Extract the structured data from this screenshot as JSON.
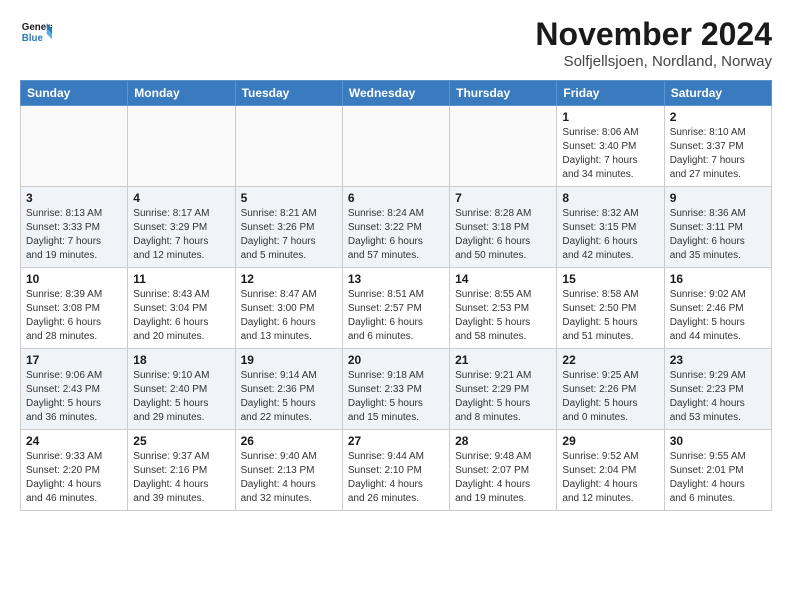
{
  "header": {
    "logo_line1": "General",
    "logo_line2": "Blue",
    "month_year": "November 2024",
    "location": "Solfjellsjoen, Nordland, Norway"
  },
  "weekdays": [
    "Sunday",
    "Monday",
    "Tuesday",
    "Wednesday",
    "Thursday",
    "Friday",
    "Saturday"
  ],
  "weeks": [
    [
      {
        "day": "",
        "info": ""
      },
      {
        "day": "",
        "info": ""
      },
      {
        "day": "",
        "info": ""
      },
      {
        "day": "",
        "info": ""
      },
      {
        "day": "",
        "info": ""
      },
      {
        "day": "1",
        "info": "Sunrise: 8:06 AM\nSunset: 3:40 PM\nDaylight: 7 hours\nand 34 minutes."
      },
      {
        "day": "2",
        "info": "Sunrise: 8:10 AM\nSunset: 3:37 PM\nDaylight: 7 hours\nand 27 minutes."
      }
    ],
    [
      {
        "day": "3",
        "info": "Sunrise: 8:13 AM\nSunset: 3:33 PM\nDaylight: 7 hours\nand 19 minutes."
      },
      {
        "day": "4",
        "info": "Sunrise: 8:17 AM\nSunset: 3:29 PM\nDaylight: 7 hours\nand 12 minutes."
      },
      {
        "day": "5",
        "info": "Sunrise: 8:21 AM\nSunset: 3:26 PM\nDaylight: 7 hours\nand 5 minutes."
      },
      {
        "day": "6",
        "info": "Sunrise: 8:24 AM\nSunset: 3:22 PM\nDaylight: 6 hours\nand 57 minutes."
      },
      {
        "day": "7",
        "info": "Sunrise: 8:28 AM\nSunset: 3:18 PM\nDaylight: 6 hours\nand 50 minutes."
      },
      {
        "day": "8",
        "info": "Sunrise: 8:32 AM\nSunset: 3:15 PM\nDaylight: 6 hours\nand 42 minutes."
      },
      {
        "day": "9",
        "info": "Sunrise: 8:36 AM\nSunset: 3:11 PM\nDaylight: 6 hours\nand 35 minutes."
      }
    ],
    [
      {
        "day": "10",
        "info": "Sunrise: 8:39 AM\nSunset: 3:08 PM\nDaylight: 6 hours\nand 28 minutes."
      },
      {
        "day": "11",
        "info": "Sunrise: 8:43 AM\nSunset: 3:04 PM\nDaylight: 6 hours\nand 20 minutes."
      },
      {
        "day": "12",
        "info": "Sunrise: 8:47 AM\nSunset: 3:00 PM\nDaylight: 6 hours\nand 13 minutes."
      },
      {
        "day": "13",
        "info": "Sunrise: 8:51 AM\nSunset: 2:57 PM\nDaylight: 6 hours\nand 6 minutes."
      },
      {
        "day": "14",
        "info": "Sunrise: 8:55 AM\nSunset: 2:53 PM\nDaylight: 5 hours\nand 58 minutes."
      },
      {
        "day": "15",
        "info": "Sunrise: 8:58 AM\nSunset: 2:50 PM\nDaylight: 5 hours\nand 51 minutes."
      },
      {
        "day": "16",
        "info": "Sunrise: 9:02 AM\nSunset: 2:46 PM\nDaylight: 5 hours\nand 44 minutes."
      }
    ],
    [
      {
        "day": "17",
        "info": "Sunrise: 9:06 AM\nSunset: 2:43 PM\nDaylight: 5 hours\nand 36 minutes."
      },
      {
        "day": "18",
        "info": "Sunrise: 9:10 AM\nSunset: 2:40 PM\nDaylight: 5 hours\nand 29 minutes."
      },
      {
        "day": "19",
        "info": "Sunrise: 9:14 AM\nSunset: 2:36 PM\nDaylight: 5 hours\nand 22 minutes."
      },
      {
        "day": "20",
        "info": "Sunrise: 9:18 AM\nSunset: 2:33 PM\nDaylight: 5 hours\nand 15 minutes."
      },
      {
        "day": "21",
        "info": "Sunrise: 9:21 AM\nSunset: 2:29 PM\nDaylight: 5 hours\nand 8 minutes."
      },
      {
        "day": "22",
        "info": "Sunrise: 9:25 AM\nSunset: 2:26 PM\nDaylight: 5 hours\nand 0 minutes."
      },
      {
        "day": "23",
        "info": "Sunrise: 9:29 AM\nSunset: 2:23 PM\nDaylight: 4 hours\nand 53 minutes."
      }
    ],
    [
      {
        "day": "24",
        "info": "Sunrise: 9:33 AM\nSunset: 2:20 PM\nDaylight: 4 hours\nand 46 minutes."
      },
      {
        "day": "25",
        "info": "Sunrise: 9:37 AM\nSunset: 2:16 PM\nDaylight: 4 hours\nand 39 minutes."
      },
      {
        "day": "26",
        "info": "Sunrise: 9:40 AM\nSunset: 2:13 PM\nDaylight: 4 hours\nand 32 minutes."
      },
      {
        "day": "27",
        "info": "Sunrise: 9:44 AM\nSunset: 2:10 PM\nDaylight: 4 hours\nand 26 minutes."
      },
      {
        "day": "28",
        "info": "Sunrise: 9:48 AM\nSunset: 2:07 PM\nDaylight: 4 hours\nand 19 minutes."
      },
      {
        "day": "29",
        "info": "Sunrise: 9:52 AM\nSunset: 2:04 PM\nDaylight: 4 hours\nand 12 minutes."
      },
      {
        "day": "30",
        "info": "Sunrise: 9:55 AM\nSunset: 2:01 PM\nDaylight: 4 hours\nand 6 minutes."
      }
    ]
  ]
}
